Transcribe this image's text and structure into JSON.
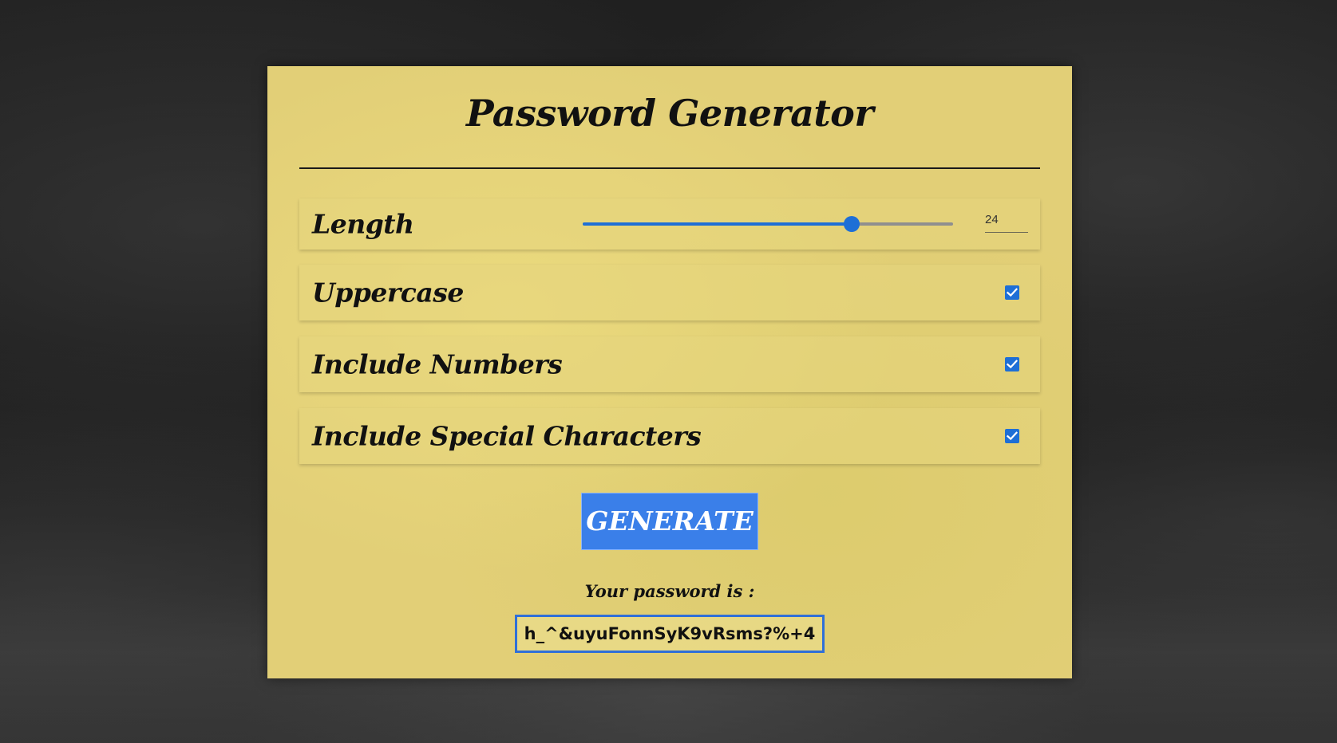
{
  "app": {
    "title": "Password Generator"
  },
  "options": {
    "length": {
      "label": "Length",
      "value": "24",
      "min": 4,
      "max": 32,
      "slider_fraction": 0.726
    },
    "uppercase": {
      "label": "Uppercase",
      "checked": true
    },
    "numbers": {
      "label": "Include Numbers",
      "checked": true
    },
    "special": {
      "label": "Include Special Characters",
      "checked": true
    }
  },
  "generate": {
    "label": "GENERATE"
  },
  "result": {
    "label": "Your password is :",
    "password": "h_^&uyuFonnSyK9vRsms?%+4"
  },
  "colors": {
    "accent": "#1e6fd6",
    "button": "#3a7fe9",
    "panel": "#e2cf77"
  },
  "icons": {
    "checkbox": "check-icon"
  }
}
